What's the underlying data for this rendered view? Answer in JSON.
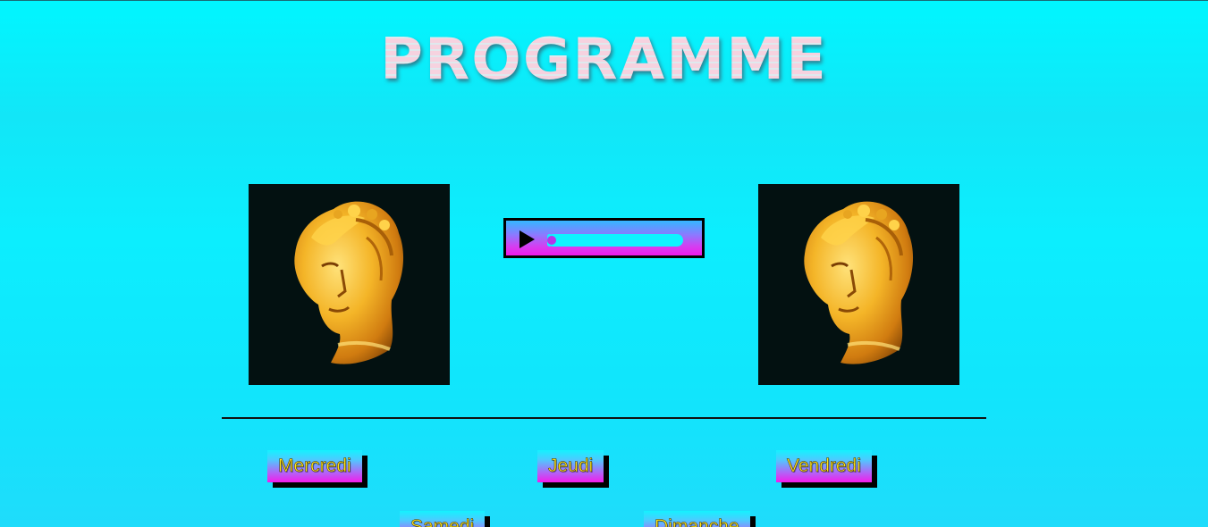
{
  "page": {
    "title": "PROGRAMME"
  },
  "images": {
    "left": {
      "icon": "golden-statue-bust-image"
    },
    "right": {
      "icon": "golden-statue-bust-image"
    }
  },
  "audio_player": {
    "play_icon": "play-icon",
    "progress": 0.0
  },
  "days": [
    {
      "label": "Mercredi"
    },
    {
      "label": "Jeudi"
    },
    {
      "label": "Vendredi"
    },
    {
      "label": "Samedi"
    },
    {
      "label": "Dimanche"
    }
  ],
  "colors": {
    "background_top": "#00f6ff",
    "background_bottom": "#1fdcfb",
    "title_fill": "#f6d2df",
    "button_text": "#ffe61a",
    "button_gradient_top": "#14f2ff",
    "button_gradient_bottom": "#f41bea",
    "divider": "#111111",
    "image_background": "#031111"
  }
}
